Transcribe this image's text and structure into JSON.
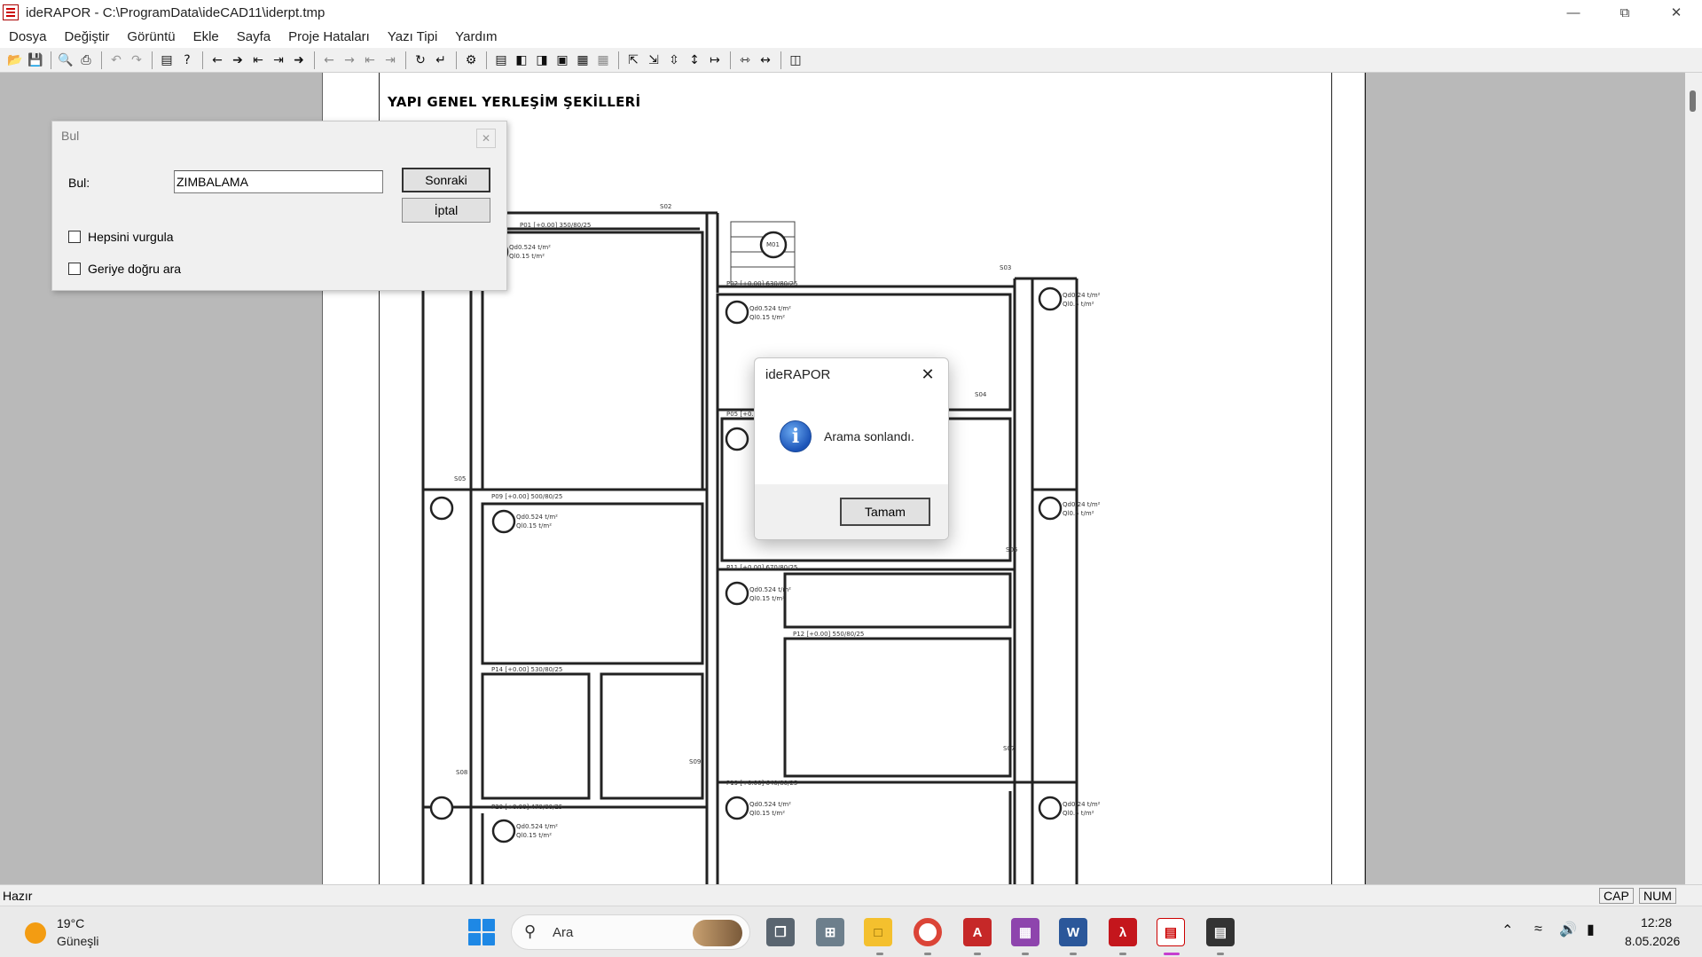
{
  "window": {
    "title": "ideRAPOR - C:\\ProgramData\\ideCAD11\\iderpt.tmp",
    "minimize_icon": "minimize-icon",
    "restore_icon": "restore-icon",
    "close_icon": "close-icon"
  },
  "menu": [
    "Dosya",
    "Değiştir",
    "Görüntü",
    "Ekle",
    "Sayfa",
    "Proje Hataları",
    "Yazı Tipi",
    "Yardım"
  ],
  "document": {
    "heading": "YAPI GENEL YERLEŞİM ŞEKİLLERİ",
    "plan_labels": {
      "s01": "S02",
      "s03": "S03",
      "s04": "S04",
      "s05": "S05",
      "s06": "S06",
      "s07": "S07",
      "s08": "S08",
      "s09": "S09",
      "p01": "P01 [+0.00]   350/80/25",
      "p02": "P02 [+0.00]   630/80/25",
      "p05": "P05 [+0.00]",
      "p09": "P09 [+0.00]   500/80/25",
      "p11": "P11 [+0.00]   670/80/25",
      "p12": "P12 [+0.00]   550/80/25",
      "p14": "P14 [+0.00]   530/80/25",
      "p19": "P19 [+0.00]   640/80/25",
      "p20": "P20 [+0.00]   470/80/25",
      "m01": "M01",
      "load1": "Qd0.524 t/m²",
      "load2": "Ql0.15 t/m²",
      "load3": "Qd0.24 t/m²",
      "load4": "Ql0.5 t/m²"
    }
  },
  "find_dialog": {
    "title": "Bul",
    "label": "Bul:",
    "value": "ZIMBALAMA",
    "next_button": "Sonraki",
    "cancel_button": "İptal",
    "highlight_all": "Hepsini vurgula",
    "search_backward": "Geriye doğru ara"
  },
  "message_dialog": {
    "title": "ideRAPOR",
    "message": "Arama sonlandı.",
    "ok_button": "Tamam",
    "icon": "info-icon"
  },
  "status": {
    "text": "Hazır",
    "cap": "CAP",
    "num": "NUM"
  },
  "taskbar": {
    "temperature": "19°C",
    "weather": "Güneşli",
    "search": "Ara",
    "time": "12:28",
    "date": "8.05.2026"
  }
}
